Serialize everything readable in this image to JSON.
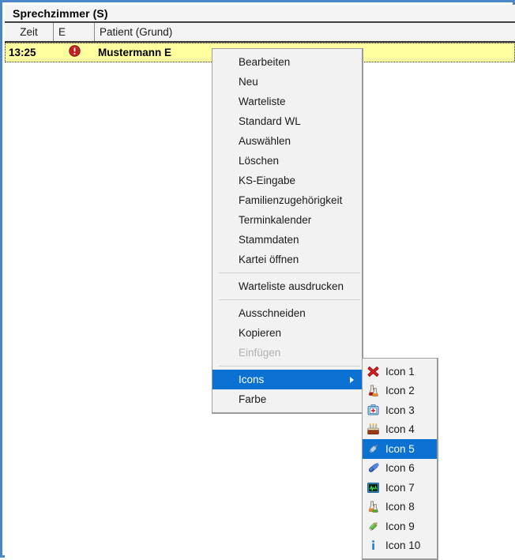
{
  "window": {
    "title": "Sprechzimmer (S)",
    "border_color": "#4a86c8"
  },
  "table": {
    "columns": [
      {
        "key": "zeit",
        "label": "Zeit"
      },
      {
        "key": "e",
        "label": "E"
      },
      {
        "key": "patient",
        "label": "Patient (Grund)"
      }
    ],
    "rows": [
      {
        "zeit": "13:25",
        "e_icon": "red-alert-exclamation-icon",
        "patient": "Mustermann E",
        "highlight_color": "#ffffa0",
        "selected": true
      }
    ]
  },
  "context_menu": {
    "items": [
      {
        "label": "Bearbeiten",
        "type": "item"
      },
      {
        "label": "Neu",
        "type": "item"
      },
      {
        "label": "Warteliste",
        "type": "item"
      },
      {
        "label": "Standard WL",
        "type": "item"
      },
      {
        "label": "Auswählen",
        "type": "item"
      },
      {
        "label": "Löschen",
        "type": "item"
      },
      {
        "label": "KS-Eingabe",
        "type": "item"
      },
      {
        "label": "Familienzugehörigkeit",
        "type": "item"
      },
      {
        "label": "Terminkalender",
        "type": "item"
      },
      {
        "label": "Stammdaten",
        "type": "item"
      },
      {
        "label": "Kartei öffnen",
        "type": "item"
      },
      {
        "label": "",
        "type": "separator"
      },
      {
        "label": "Warteliste ausdrucken",
        "type": "item"
      },
      {
        "label": "",
        "type": "separator"
      },
      {
        "label": "Ausschneiden",
        "type": "item"
      },
      {
        "label": "Kopieren",
        "type": "item"
      },
      {
        "label": "Einfügen",
        "type": "item",
        "disabled": true
      },
      {
        "label": "",
        "type": "separator"
      },
      {
        "label": "Icons",
        "type": "submenu",
        "selected": true,
        "arrow_icon": "chevron-right-icon"
      },
      {
        "label": "Farbe",
        "type": "item"
      }
    ],
    "highlight_color": "#0b72d4"
  },
  "icons_submenu": {
    "items": [
      {
        "label": "Icon 1",
        "icon": "red-cross-x-icon"
      },
      {
        "label": "Icon 2",
        "icon": "lab-flasks-red-orange-icon"
      },
      {
        "label": "Icon 3",
        "icon": "medical-first-aid-bag-icon"
      },
      {
        "label": "Icon 4",
        "icon": "birthday-cake-icon"
      },
      {
        "label": "Icon 5",
        "icon": "syringe-icon",
        "selected": true
      },
      {
        "label": "Icon 6",
        "icon": "blue-pill-capsule-icon"
      },
      {
        "label": "Icon 7",
        "icon": "ecg-monitor-icon"
      },
      {
        "label": "Icon 8",
        "icon": "lab-flasks-orange-green-icon"
      },
      {
        "label": "Icon 9",
        "icon": "green-pencil-icon"
      },
      {
        "label": "Icon 10",
        "icon": "blue-info-icon"
      }
    ],
    "highlight_color": "#0b72d4"
  }
}
